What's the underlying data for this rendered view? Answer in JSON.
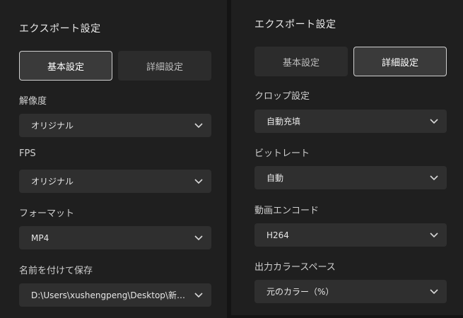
{
  "left_panel": {
    "title": "エクスポート設定",
    "tabs": [
      {
        "label": "基本設定",
        "active": true
      },
      {
        "label": "詳細設定",
        "active": false
      }
    ],
    "fields": [
      {
        "label": "解像度",
        "value": "オリジナル"
      },
      {
        "label": "FPS",
        "value": "オリジナル"
      },
      {
        "label": "フォーマット",
        "value": "MP4"
      },
      {
        "label": "名前を付けて保存",
        "value": "D:\\Users\\xushengpeng\\Desktop\\新しいフォルダー"
      }
    ]
  },
  "right_panel": {
    "title": "エクスポート設定",
    "tabs": [
      {
        "label": "基本設定",
        "active": false
      },
      {
        "label": "詳細設定",
        "active": true
      }
    ],
    "fields": [
      {
        "label": "クロップ設定",
        "value": "自動充填"
      },
      {
        "label": "ビットレート",
        "value": "自動"
      },
      {
        "label": "動画エンコード",
        "value": "H264"
      },
      {
        "label": "出力カラースペース",
        "value": "元のカラー（%）"
      }
    ]
  },
  "icons": {
    "dropdown": "chevron-down-icon"
  },
  "colors": {
    "panel_bg": "#1f1f1f",
    "field_bg": "#2f2f2f",
    "active_tab_border": "#cfcfcf"
  }
}
